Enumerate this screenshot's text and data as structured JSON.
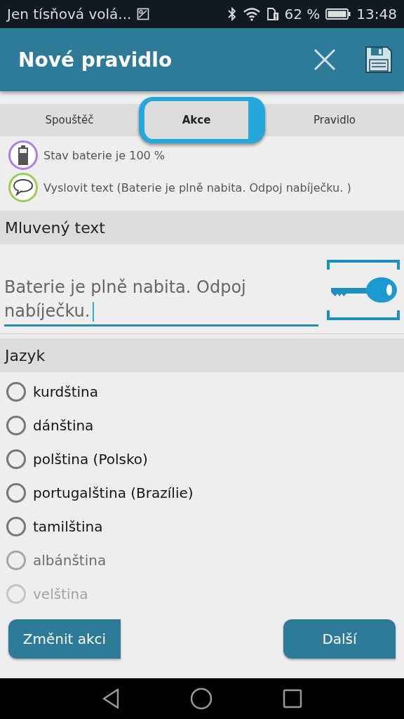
{
  "status_bar": {
    "carrier": "Jen tísňová volá...",
    "battery_percent": "62 %",
    "time": "13:48"
  },
  "app_bar": {
    "title": "Nové pravidlo"
  },
  "tabs": [
    {
      "label": "Spouštěč",
      "selected": false
    },
    {
      "label": "Akce",
      "selected": true
    },
    {
      "label": "Pravidlo",
      "selected": false
    }
  ],
  "summary": [
    {
      "kind": "battery",
      "color": "#a77fe6",
      "text": "Stav baterie je 100 %"
    },
    {
      "kind": "speech",
      "color": "#99cc55",
      "text": "Vyslovit text (Baterie je plně nabita. Odpoj nabíječku. )"
    }
  ],
  "spoken_text": {
    "header": "Mluvený text",
    "value": "Baterie je plně nabita. Odpoj nabíječku."
  },
  "language": {
    "header": "Jazyk",
    "options": [
      {
        "label": "kurdština",
        "selected": false,
        "kind": "normal"
      },
      {
        "label": "dánština",
        "selected": false,
        "kind": "normal"
      },
      {
        "label": "polština (Polsko)",
        "selected": false,
        "kind": "normal"
      },
      {
        "label": "portugalština (Brazílie)",
        "selected": false,
        "kind": "normal"
      },
      {
        "label": "tamilština",
        "selected": false,
        "kind": "normal"
      },
      {
        "label": "albánština",
        "selected": false,
        "kind": "fading"
      },
      {
        "label": "velština",
        "selected": false,
        "kind": "faint"
      }
    ]
  },
  "buttons": {
    "back": "Změnit akci",
    "next": "Další"
  }
}
